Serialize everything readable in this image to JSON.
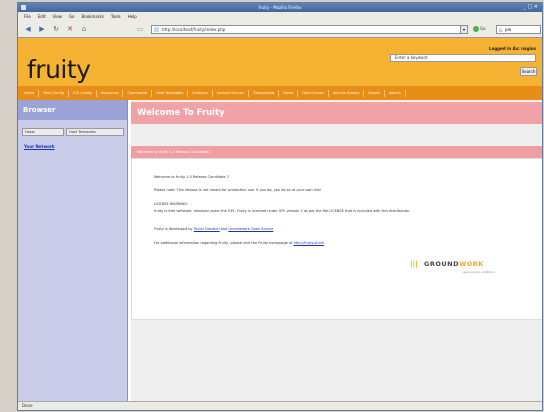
{
  "window": {
    "title": "fruity - Mozilla Firefox",
    "controls": "_ □ ✕"
  },
  "menu": [
    "File",
    "Edit",
    "View",
    "Go",
    "Bookmarks",
    "Tools",
    "Help"
  ],
  "toolbar": {
    "url": "http://localhost/fruity/index.php",
    "go_label": "Go",
    "search_value": "pie"
  },
  "header": {
    "logo": "fruity",
    "logged_in": "Logged in As: nagios",
    "search_placeholder": "Enter a keyword",
    "search_button": "Search"
  },
  "nav": [
    "Home",
    "Main Config",
    "CGI Config",
    "Resources",
    "Commands",
    "Host Templates",
    "Contacts",
    "Contact Groups",
    "Timeperiods",
    "Hosts",
    "Host Groups",
    "Service Groups",
    "Export",
    "Search"
  ],
  "sidebar": {
    "title": "Browser",
    "tabs": [
      "Hosts",
      "Host Templates"
    ],
    "link": "Your Network"
  },
  "main": {
    "welcome_title": "Welcome To Fruity",
    "panel_title": "Welcome to fruity 1.0 Release Candidate 2",
    "lines": [
      "Welcome to fruity 1.0 Release Candidate 2",
      "Please note: This release is not meant for production use. If you do, you do so at your own risk!",
      "LICENSE WARNING:",
      "fruity is free software, released under the GPL. Fruity is licensed under GPL version 2 as per the file LICENSE that is included with this distribution.",
      "Fruity is developed by",
      "and",
      "For additional information regarding Fruity, please visit the Fruity homepage at"
    ],
    "link_dev1": "Taylor Dondich",
    "link_dev2": "Groundwork Open Source",
    "link_home": "http://fruity.sf.net",
    "groundwork": {
      "mark": "|||",
      "name_a": "GROUND",
      "name_b": "WORK",
      "tagline": "open source solutions"
    }
  },
  "status": "Done"
}
